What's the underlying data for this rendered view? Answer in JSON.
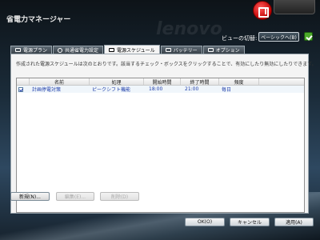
{
  "window": {
    "title": "省電力マネージャー",
    "brand": "lenovo"
  },
  "view_switch": {
    "label": "ビューの切替:",
    "button": "ベーシックへ(B)"
  },
  "tabs": [
    {
      "label": "電源プラン",
      "icon": "plug-icon"
    },
    {
      "label": "共通省電力設定",
      "icon": "gear-icon"
    },
    {
      "label": "電源スケジュール",
      "icon": "calendar-icon",
      "active": true
    },
    {
      "label": "バッテリー",
      "icon": "battery-icon"
    },
    {
      "label": "オプション",
      "icon": "check-icon"
    }
  ],
  "description": "作成された電源スケジュールは次のとおりです。該当するチェック・ボックスをクリックすることで、有効にしたり無効にしたりできます。",
  "table": {
    "headers": [
      "名前",
      "処理",
      "開始時間",
      "終了時間",
      "頻度"
    ],
    "rows": [
      {
        "checked": true,
        "name": "計画停電対策",
        "action": "ピークシフト機能",
        "start": "18:00",
        "end": "21:00",
        "frequency": "毎日"
      }
    ]
  },
  "panel_buttons": {
    "new": "新規(N)...",
    "edit": "編集(E)...",
    "delete": "削除(D)"
  },
  "footer": {
    "ok": "OK(O)",
    "cancel": "キャンセル",
    "apply": "適用(A)"
  }
}
